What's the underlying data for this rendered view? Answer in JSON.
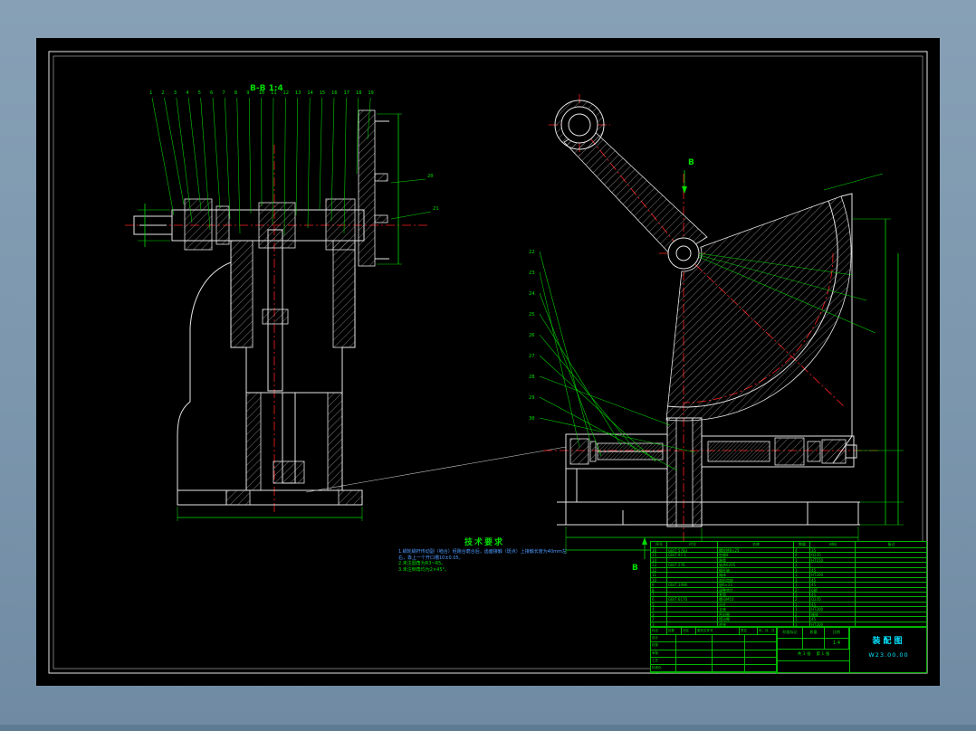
{
  "labels": {
    "view": "B-B  1:4",
    "section_top": "B",
    "section_bottom": "B"
  },
  "callouts": {
    "left": [
      "1",
      "2",
      "3",
      "4",
      "5",
      "6",
      "7",
      "8",
      "9",
      "10",
      "11",
      "12",
      "13",
      "14",
      "15",
      "16",
      "17",
      "18",
      "19"
    ],
    "side": [
      "20",
      "21"
    ],
    "right": [
      "22",
      "23",
      "24",
      "25",
      "26",
      "27",
      "28",
      "29",
      "30"
    ]
  },
  "tech": {
    "title": "技术要求",
    "items": [
      "1.蜗轮蜗杆传动副（啮合）经跑合磨合后，齿面接触（斑点）上接触长度为40mm左右，靠上一个开口槽10±0.05。",
      "2.未注圆角为R3~R5。",
      "3.未注倒角均为2×45°。"
    ]
  },
  "bom": {
    "headers": [
      "序号",
      "代号",
      "名称",
      "数量",
      "材料",
      "备注"
    ],
    "rows": [
      {
        "no": "16",
        "code": "GB/T 5783",
        "name": "螺栓M8×25",
        "qty": "4",
        "material": "35",
        "note": ""
      },
      {
        "no": "15",
        "code": "GB/T 97.1",
        "name": "垫圈8",
        "qty": "4",
        "material": "Q235",
        "note": ""
      },
      {
        "no": "14",
        "code": "",
        "name": "端盖",
        "qty": "1",
        "material": "HT150",
        "note": ""
      },
      {
        "no": "13",
        "code": "GB/T 276",
        "name": "轴承6205",
        "qty": "2",
        "material": "",
        "note": ""
      },
      {
        "no": "12",
        "code": "",
        "name": "蜗杆轴",
        "qty": "1",
        "material": "45",
        "note": ""
      },
      {
        "no": "11",
        "code": "",
        "name": "箱体",
        "qty": "1",
        "material": "HT200",
        "note": ""
      },
      {
        "no": "10",
        "code": "",
        "name": "扇形齿轮",
        "qty": "1",
        "material": "45",
        "note": ""
      },
      {
        "no": "9",
        "code": "GB/T 1096",
        "name": "键6×22",
        "qty": "1",
        "material": "45",
        "note": ""
      },
      {
        "no": "8",
        "code": "",
        "name": "调整垫片",
        "qty": "2",
        "material": "08F",
        "note": ""
      },
      {
        "no": "7",
        "code": "",
        "name": "套筒",
        "qty": "1",
        "material": "45",
        "note": ""
      },
      {
        "no": "6",
        "code": "GB/T 6170",
        "name": "螺母M10",
        "qty": "2",
        "material": "Q235",
        "note": ""
      },
      {
        "no": "5",
        "code": "",
        "name": "丝杠",
        "qty": "1",
        "material": "45",
        "note": ""
      },
      {
        "no": "4",
        "code": "",
        "name": "支座",
        "qty": "1",
        "material": "HT200",
        "note": ""
      },
      {
        "no": "3",
        "code": "",
        "name": "密封圈",
        "qty": "2",
        "material": "橡胶",
        "note": ""
      },
      {
        "no": "2",
        "code": "",
        "name": "摆动臂",
        "qty": "1",
        "material": "45",
        "note": ""
      },
      {
        "no": "1",
        "code": "",
        "name": "底座",
        "qty": "1",
        "material": "HT200",
        "note": ""
      }
    ]
  },
  "title_block": {
    "name": "装配图",
    "drawing_no": "W23.00.00",
    "stage_label": "阶段标记",
    "weight_label": "质量",
    "scale_label": "比例",
    "scale": "1:4",
    "sheet_total": "共 1 张",
    "sheet_no": "第 1 张",
    "sign_rows": [
      "设计",
      "校核",
      "审核",
      "工艺",
      "标准化",
      "批准"
    ],
    "change_cols": [
      "标记",
      "处数",
      "分区",
      "更改文件号",
      "签名",
      "年、月、日"
    ]
  },
  "colors": {
    "background": "#7e99b0",
    "canvas": "#000000",
    "geometry": "#e6e6e6",
    "dimension": "#00dc00",
    "centerline": "#ff2020",
    "highlight": "#4f9bff",
    "accent": "#00e5ff"
  }
}
